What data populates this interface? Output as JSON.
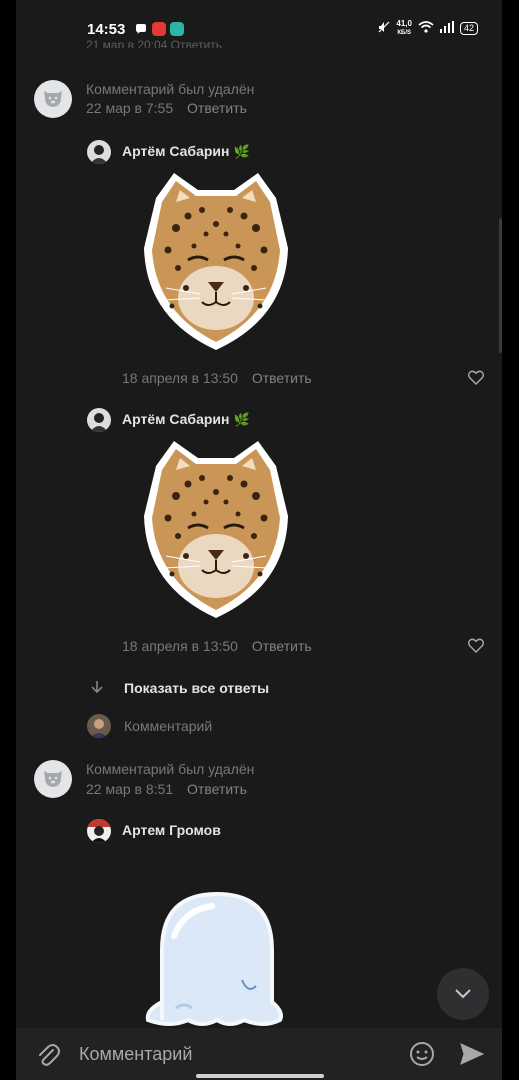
{
  "status_bar": {
    "time": "14:53",
    "network_speed_top": "41,0",
    "network_speed_bottom": "КБ/S",
    "battery": "42"
  },
  "cutoff_text": "21 мар в 20:04   Ответить",
  "comments": [
    {
      "type": "deleted",
      "text": "Комментарий был удалён",
      "date": "22 мар в 7:55",
      "reply_label": "Ответить"
    },
    {
      "type": "reply",
      "author": "Артём Сабарин",
      "badge": "🌿",
      "date": "18 апреля в 13:50",
      "reply_label": "Ответить",
      "sticker": "leopard-sticker"
    },
    {
      "type": "reply",
      "author": "Артём Сабарин",
      "badge": "🌿",
      "date": "18 апреля в 13:50",
      "reply_label": "Ответить",
      "sticker": "leopard-sticker"
    },
    {
      "type": "deleted",
      "text": "Комментарий был удалён",
      "date": "22 мар в 8:51",
      "reply_label": "Ответить"
    },
    {
      "type": "reply",
      "author": "Артем Громов",
      "sticker": "ghost-sticker"
    }
  ],
  "show_all_replies": "Показать все ответы",
  "reply_input_placeholder": "Комментарий",
  "input_bar": {
    "placeholder": "Комментарий",
    "attach_icon": "paperclip-icon",
    "emoji_icon": "smile-icon",
    "send_icon": "send-icon"
  },
  "colors": {
    "background": "#1a1a1a",
    "text_primary": "#e1e3e6",
    "text_secondary": "#76787a"
  }
}
